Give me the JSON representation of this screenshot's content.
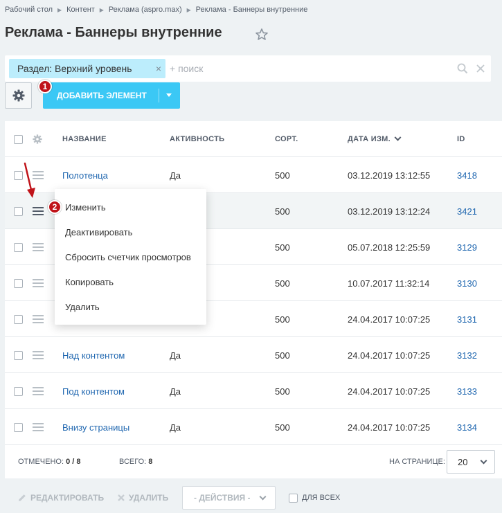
{
  "breadcrumb": [
    "Рабочий стол",
    "Контент",
    "Реклама (aspro.max)",
    "Реклама - Баннеры внутренние"
  ],
  "title": "Реклама - Баннеры внутренние",
  "filter": {
    "tag": "Раздел: Верхний уровень",
    "placeholder": "+ поиск"
  },
  "toolbar": {
    "add_label": "ДОБАВИТЬ ЭЛЕМЕНТ"
  },
  "annotations": {
    "badge1": "1",
    "badge2": "2"
  },
  "table": {
    "headers": {
      "name": "НАЗВАНИЕ",
      "active": "АКТИВНОСТЬ",
      "sort": "СОРТ.",
      "date": "ДАТА ИЗМ.",
      "id": "ID"
    },
    "rows": [
      {
        "name": "Полотенца",
        "active": "Да",
        "sort": "500",
        "date": "03.12.2019 13:12:55",
        "id": "3418"
      },
      {
        "name": "",
        "active": "",
        "sort": "500",
        "date": "03.12.2019 13:12:24",
        "id": "3421"
      },
      {
        "name": "",
        "active": "",
        "sort": "500",
        "date": "05.07.2018 12:25:59",
        "id": "3129"
      },
      {
        "name": "",
        "active": "",
        "sort": "500",
        "date": "10.07.2017 11:32:14",
        "id": "3130"
      },
      {
        "name": "",
        "active": "",
        "sort": "500",
        "date": "24.04.2017 10:07:25",
        "id": "3131"
      },
      {
        "name": "Над контентом",
        "active": "Да",
        "sort": "500",
        "date": "24.04.2017 10:07:25",
        "id": "3132"
      },
      {
        "name": "Под контентом",
        "active": "Да",
        "sort": "500",
        "date": "24.04.2017 10:07:25",
        "id": "3133"
      },
      {
        "name": "Внизу страницы",
        "active": "Да",
        "sort": "500",
        "date": "24.04.2017 10:07:25",
        "id": "3134"
      }
    ]
  },
  "context_menu": [
    "Изменить",
    "Деактивировать",
    "Сбросить счетчик просмотров",
    "Копировать",
    "Удалить"
  ],
  "footer": {
    "selected_label": "ОТМЕЧЕНО:",
    "selected_value": "0 / 8",
    "total_label": "ВСЕГО:",
    "total_value": "8",
    "per_page_label": "НА СТРАНИЦЕ:",
    "per_page_value": "20"
  },
  "actions": {
    "edit": "РЕДАКТИРОВАТЬ",
    "delete": "УДАЛИТЬ",
    "select": "- ДЕЙСТВИЯ -",
    "for_all": "ДЛЯ ВСЕХ"
  },
  "colors": {
    "accent": "#3bc8f5",
    "link": "#2067b0",
    "badge": "#c0141a",
    "filter_tag": "#bcedfc"
  }
}
